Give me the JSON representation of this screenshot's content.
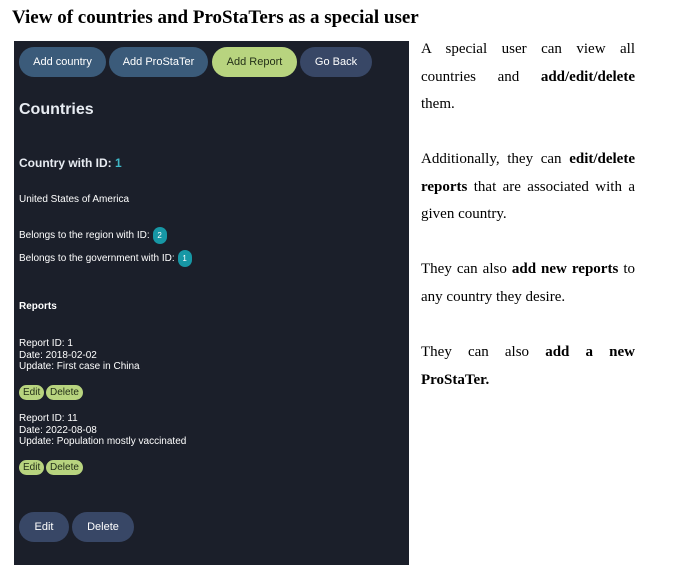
{
  "page_title": "View of countries and ProStaTers as a special user",
  "nav": {
    "add_country": "Add country",
    "add_prostater": "Add ProStaTer",
    "add_report": "Add Report",
    "go_back": "Go Back"
  },
  "section_title": "Countries",
  "country": {
    "id_label": "Country with ID:",
    "id_value": "1",
    "name": "United States of America",
    "region_label": "Belongs to the region with ID:",
    "region_id": "2",
    "government_label": "Belongs to the government with ID:",
    "government_id": "1"
  },
  "reports_title": "Reports",
  "reports": [
    {
      "id_line": "Report ID: 1",
      "date_line": "Date: 2018-02-02",
      "update_line": "Update: First case in China"
    },
    {
      "id_line": "Report ID: 11",
      "date_line": "Date: 2022-08-08",
      "update_line": "Update: Population mostly vaccinated"
    }
  ],
  "report_actions": {
    "edit": "Edit",
    "delete": "Delete"
  },
  "footer_actions": {
    "edit": "Edit",
    "delete": "Delete"
  },
  "description": {
    "p1": {
      "a": "A special user can view all countries and ",
      "b": "add/edit/delete",
      "c": " them."
    },
    "p2": {
      "a": "Additionally, they can ",
      "b": "edit/delete reports",
      "c": " that are associated with a given country."
    },
    "p3": {
      "a": "They can also ",
      "b": "add new reports",
      "c": " to any country they desire."
    },
    "p4": {
      "a": "They can also ",
      "b": "add a new ProStaTer.",
      "c": ""
    }
  }
}
